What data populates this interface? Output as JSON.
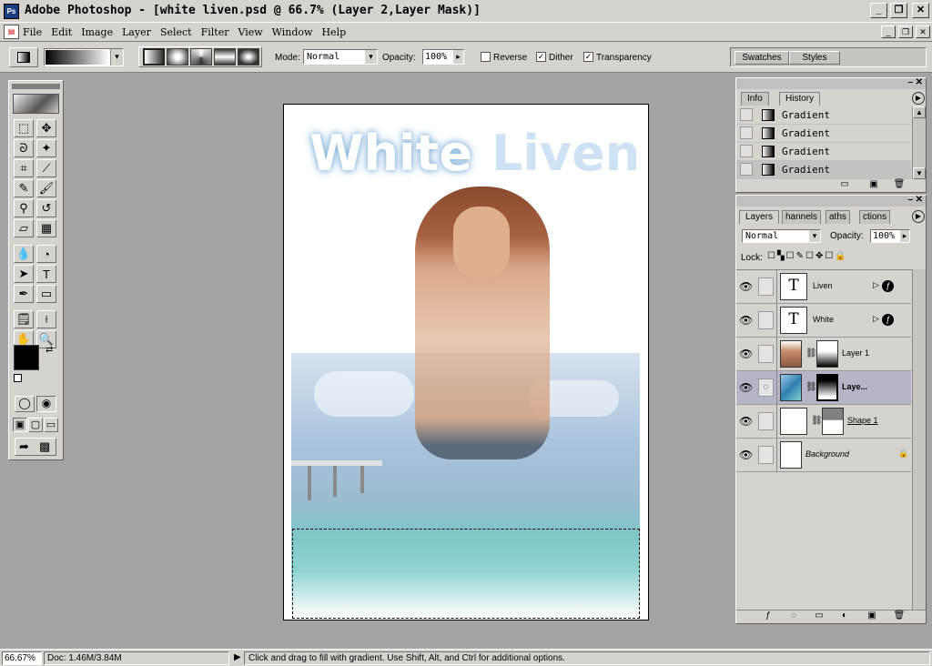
{
  "window": {
    "title": "Adobe Photoshop - [white liven.psd @ 66.7% (Layer 2,Layer Mask)]",
    "app_icon": "Ps",
    "controls": [
      "_",
      "❐",
      "✕"
    ]
  },
  "menu": {
    "items": [
      "File",
      "Edit",
      "Image",
      "Layer",
      "Select",
      "Filter",
      "View",
      "Window",
      "Help"
    ],
    "mdi_controls": [
      "_",
      "❐",
      "✕"
    ]
  },
  "options": {
    "mode_label": "Mode:",
    "mode_value": "Normal",
    "opacity_label": "Opacity:",
    "opacity_value": "100%",
    "reverse_label": "Reverse",
    "reverse_checked": false,
    "dither_label": "Dither",
    "dither_checked": true,
    "transparency_label": "Transparency",
    "transparency_checked": true,
    "check_mark": "✓",
    "dropdown_arrow": "▾",
    "stepper_arrow": "▸",
    "palette_tabs": [
      "Swatches",
      "Styles"
    ]
  },
  "toolbox": {
    "tools": [
      [
        "marquee-icon",
        "⬚"
      ],
      [
        "move-icon",
        "✥"
      ],
      [
        "lasso-icon",
        "ᘐ"
      ],
      [
        "magic-wand-icon",
        "✦"
      ],
      [
        "crop-icon",
        "⌗"
      ],
      [
        "slice-icon",
        "⟋"
      ],
      [
        "healing-brush-icon",
        "✎"
      ],
      [
        "brush-icon",
        "🖌"
      ],
      [
        "clone-stamp-icon",
        "⚲"
      ],
      [
        "history-brush-icon",
        "↺"
      ],
      [
        "eraser-icon",
        "▱"
      ],
      [
        "gradient-icon",
        "▦"
      ],
      [
        "blur-icon",
        "💧"
      ],
      [
        "dodge-icon",
        "◔"
      ],
      [
        "path-select-icon",
        "➤"
      ],
      [
        "type-icon",
        "T"
      ],
      [
        "pen-icon",
        "✒"
      ],
      [
        "rectangle-icon",
        "▭"
      ],
      [
        "notes-icon",
        "🗒"
      ],
      [
        "eyedropper-icon",
        "⟊"
      ],
      [
        "hand-icon",
        "✋"
      ],
      [
        "zoom-icon",
        "🔍"
      ]
    ],
    "swap_icon": "⇄",
    "mode_icons": [
      "◯",
      "◉"
    ],
    "screen_icons": [
      "▣",
      "▢",
      "▭"
    ],
    "jump_icons": [
      "➦",
      "▩"
    ]
  },
  "document": {
    "heading_word1": "White",
    "heading_word2": "Liven"
  },
  "history_panel": {
    "tabs": [
      "Info",
      "History"
    ],
    "active_tab": "History",
    "items": [
      "Gradient",
      "Gradient",
      "Gradient",
      "Gradient"
    ],
    "footer_icons": [
      "▭",
      "▣",
      "🗑"
    ]
  },
  "layers_panel": {
    "tabs": [
      "Layers",
      "Channels",
      "Paths",
      "Actions"
    ],
    "tab_labels_visible": [
      "Layers",
      "hannels",
      "aths",
      "ctions"
    ],
    "active_tab": "Layers",
    "blend_mode": "Normal",
    "opacity_label": "Opacity:",
    "opacity_value": "100%",
    "lock_label": "Lock:",
    "lock_icons": [
      "☐",
      "▚",
      "☐",
      "✎",
      "☐",
      "✥",
      "☐",
      "🔒"
    ],
    "layers": [
      {
        "name": "Liven",
        "type": "text",
        "thumb": "T",
        "effects": "ƒ"
      },
      {
        "name": "White",
        "type": "text",
        "thumb": "T",
        "effects": "ƒ"
      },
      {
        "name": "Layer 1",
        "type": "image-mask"
      },
      {
        "name": "Laye...",
        "type": "image-mask",
        "selected": true
      },
      {
        "name": "Shape 1",
        "type": "shape"
      },
      {
        "name": "Background",
        "type": "background",
        "locked": true
      }
    ],
    "footer_icons": [
      "ƒ",
      "◌",
      "▭",
      "◐",
      "▣",
      "🗑"
    ]
  },
  "status": {
    "zoom": "66.67%",
    "doc_info": "Doc: 1.46M/3.84M",
    "arrow": "▶",
    "message": "Click and drag to fill with gradient.  Use Shift, Alt, and Ctrl for additional options."
  },
  "colors": {
    "chrome": "#d6d3ce",
    "workspace": "#a4a4a4",
    "selected_layer": "#b4b6c8",
    "heading_white_glow": "#9fc6e6",
    "heading_liven": "#cfe2f5"
  }
}
